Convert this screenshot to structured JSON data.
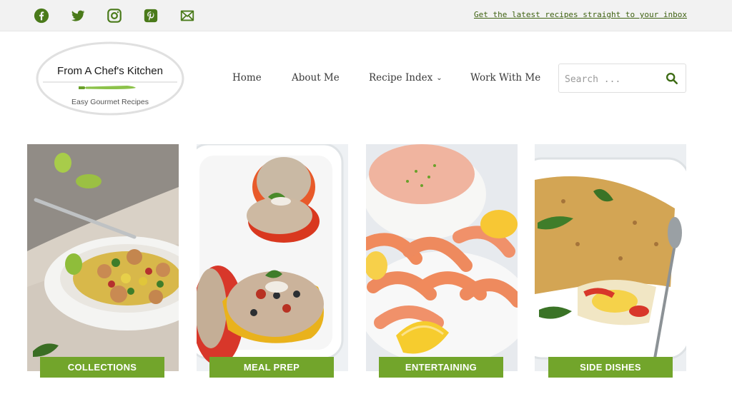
{
  "topbar": {
    "social": [
      {
        "icon": "facebook-icon"
      },
      {
        "icon": "twitter-icon"
      },
      {
        "icon": "instagram-icon"
      },
      {
        "icon": "pinterest-icon"
      },
      {
        "icon": "email-icon"
      }
    ],
    "inbox_link": "Get the latest recipes straight to your inbox"
  },
  "logo": {
    "title": "From A Chef's Kitchen",
    "tagline": "Easy Gourmet Recipes"
  },
  "nav": {
    "items": [
      {
        "label": "Home"
      },
      {
        "label": "About Me"
      },
      {
        "label": "Recipe Index",
        "dropdown": true
      },
      {
        "label": "Work With Me"
      }
    ]
  },
  "search": {
    "placeholder": "Search ..."
  },
  "categories": [
    {
      "label": "COLLECTIONS"
    },
    {
      "label": "MEAL PREP"
    },
    {
      "label": "ENTERTAINING"
    },
    {
      "label": "SIDE DISHES"
    }
  ],
  "colors": {
    "accent_green": "#72a52b",
    "icon_green": "#4a7a1a",
    "topbar_bg": "#f2f2f2"
  }
}
